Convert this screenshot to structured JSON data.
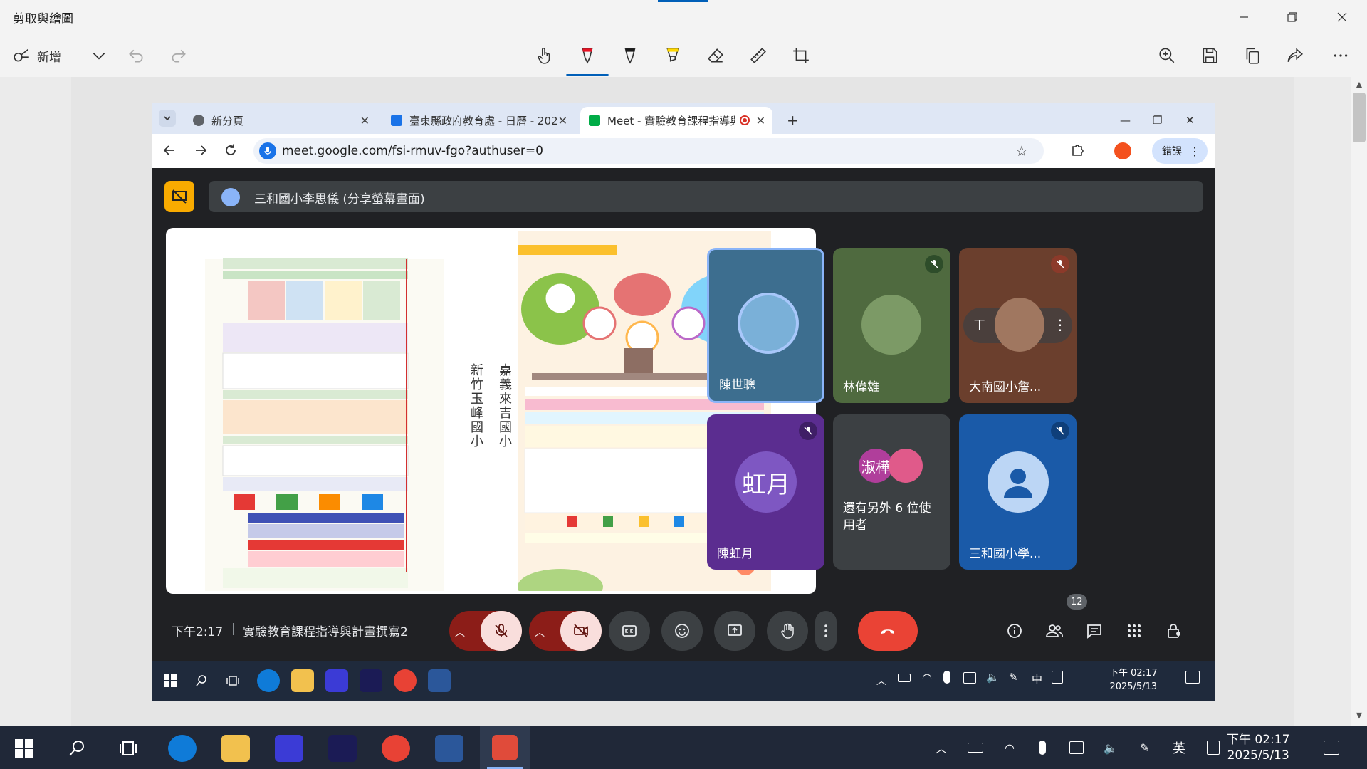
{
  "app": {
    "title": "剪取與繪圖",
    "new_label": "新增"
  },
  "browser": {
    "tabs": [
      {
        "label": "新分頁"
      },
      {
        "label": "臺東縣政府教育處 - 日曆 - 202"
      },
      {
        "label": "Meet - 實驗教育課程指導與"
      }
    ],
    "url": "meet.google.com/fsi-rmuv-fgo?authuser=0",
    "error_label": "錯誤"
  },
  "meet": {
    "presenter_label": "三和國小李思儀 (分享螢幕畫面)",
    "shared_doc": {
      "vertical_labels": [
        "新竹玉峰國小",
        "嘉義來吉國小"
      ]
    },
    "participants": [
      {
        "name": "陳世聰"
      },
      {
        "name": "林偉雄"
      },
      {
        "name": "大南國小詹..."
      },
      {
        "name": "陳虹月",
        "avatar_text": "虹月"
      },
      {
        "name": "還有另外 6 位使用者",
        "avatar_text": "淑樺"
      },
      {
        "name": "三和國小學..."
      }
    ],
    "time": "下午2:17",
    "meeting_title": "實驗教育課程指導與計畫撰寫2",
    "people_count": "12"
  },
  "inner_taskbar": {
    "time": "下午 02:17",
    "date": "2025/5/13",
    "ime": "中"
  },
  "taskbar": {
    "time": "下午 02:17",
    "date": "2025/5/13",
    "ime": "英"
  },
  "colors": {
    "accent": "#005fb8",
    "meet_bg": "#202124",
    "end_call": "#ea4335",
    "mute_red": "#f9dedc"
  }
}
